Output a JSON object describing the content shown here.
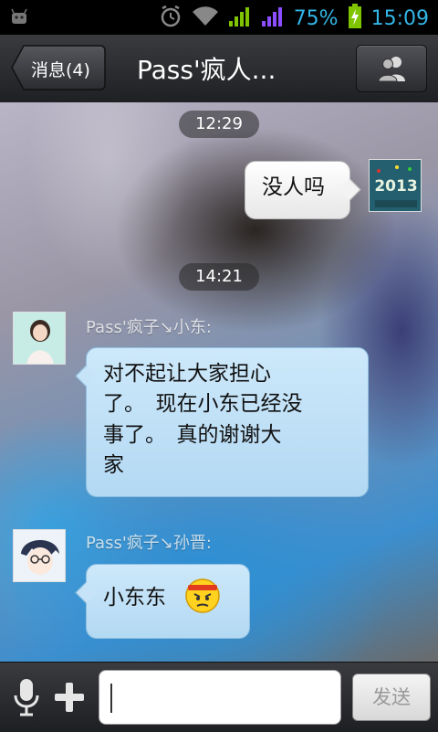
{
  "status_bar": {
    "battery_percent": "75%",
    "time": "15:09",
    "icons": [
      "android-debug-icon",
      "alarm-icon",
      "wifi-icon",
      "signal-icon",
      "signal-icon-2",
      "battery-charging-icon"
    ]
  },
  "header": {
    "back_label": "消息(4)",
    "title": "Pass'疯人...",
    "profile_icon": "contacts-icon"
  },
  "messages": [
    {
      "type": "timestamp",
      "text": "12:29"
    },
    {
      "type": "outgoing",
      "text": "没人吗",
      "avatar": "avatar-2013-image"
    },
    {
      "type": "timestamp",
      "text": "14:21"
    },
    {
      "type": "incoming",
      "sender": "Pass'疯子↘小东:",
      "text_lines": [
        "对不起让大家担心",
        "了。　现在小东已经没",
        "事了。　真的谢谢大",
        "家"
      ],
      "avatar": "avatar-girl-image"
    },
    {
      "type": "incoming",
      "sender": "Pass'疯子↘孙晋:",
      "text": "小东东",
      "emoji": "angry-headband-emoji",
      "avatar": "avatar-anime-boy-image"
    }
  ],
  "input_bar": {
    "voice_icon": "microphone-icon",
    "more_icon": "plus-icon",
    "input_value": "",
    "send_label": "发送"
  },
  "colors": {
    "status_accent": "#33b5e5",
    "incoming_bubble": "#c6e3f8",
    "outgoing_bubble": "#f2f2f2",
    "header_bg": "#2c2d31"
  }
}
